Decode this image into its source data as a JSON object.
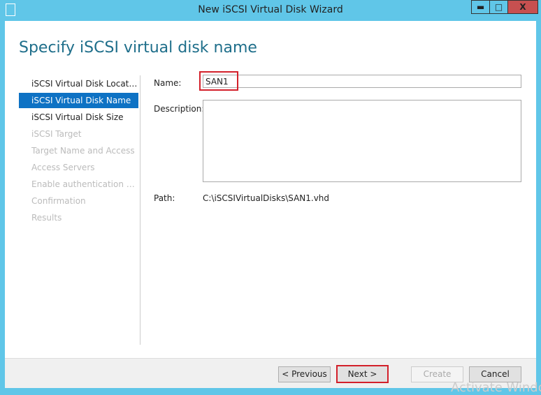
{
  "window": {
    "title": "New iSCSI Virtual Disk Wizard",
    "minimize": "▬",
    "maximize": "□",
    "close": "X"
  },
  "heading": "Specify iSCSI virtual disk name",
  "nav": [
    {
      "label": "iSCSI Virtual Disk Location",
      "state": "done"
    },
    {
      "label": "iSCSI Virtual Disk Name",
      "state": "selected"
    },
    {
      "label": "iSCSI Virtual Disk Size",
      "state": "done"
    },
    {
      "label": "iSCSI Target",
      "state": "disabled"
    },
    {
      "label": "Target Name and Access",
      "state": "disabled"
    },
    {
      "label": "Access Servers",
      "state": "disabled"
    },
    {
      "label": "Enable authentication service",
      "state": "disabled"
    },
    {
      "label": "Confirmation",
      "state": "disabled"
    },
    {
      "label": "Results",
      "state": "disabled"
    }
  ],
  "form": {
    "name_label": "Name:",
    "name_value": "SAN1",
    "description_label": "Description:",
    "description_value": "",
    "path_label": "Path:",
    "path_value": "C:\\iSCSIVirtualDisks\\SAN1.vhd"
  },
  "buttons": {
    "previous": "< Previous",
    "next": "Next >",
    "create": "Create",
    "cancel": "Cancel"
  },
  "watermark": "Activate Windows",
  "colors": {
    "accent": "#0e72c4",
    "highlight": "#d3202a"
  }
}
